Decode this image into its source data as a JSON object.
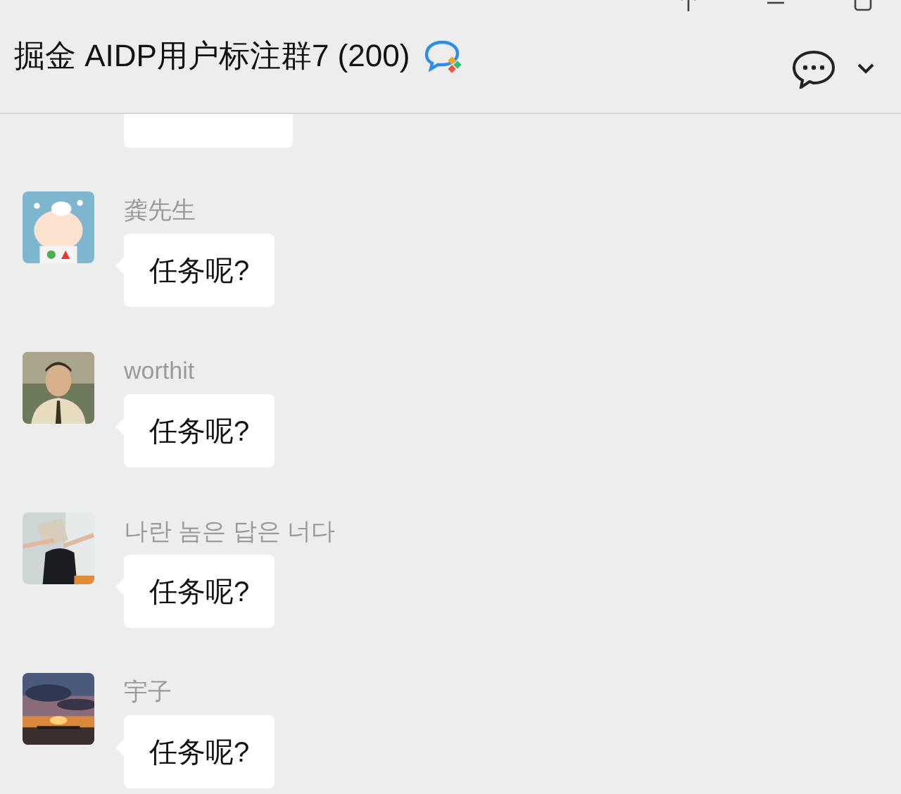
{
  "header": {
    "title": "掘金 AIDP用户标注群7 (200)"
  },
  "messages": [
    {
      "sender": "龚先生",
      "text": "任务呢?"
    },
    {
      "sender": "worthit",
      "text": "任务呢?"
    },
    {
      "sender": "나란 놈은 답은 너다",
      "text": "任务呢?"
    },
    {
      "sender": "宇子",
      "text": "任务呢?"
    }
  ]
}
